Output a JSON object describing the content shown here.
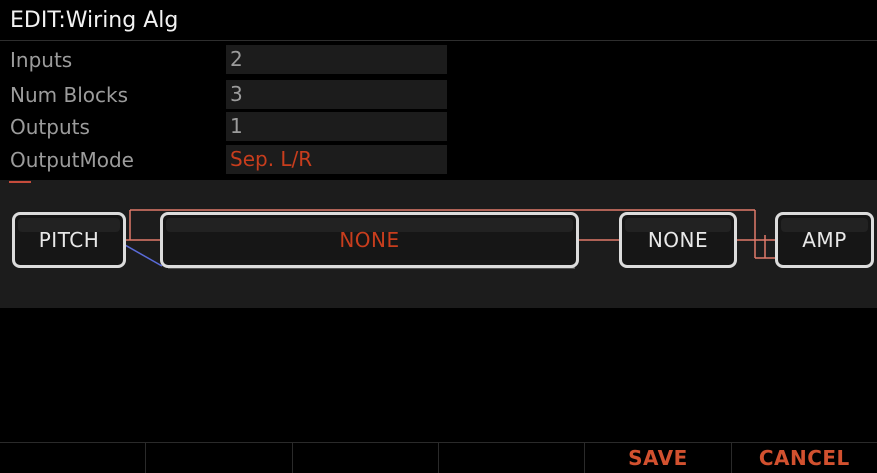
{
  "title": "EDIT:Wiring Alg",
  "params": [
    {
      "label": "Inputs",
      "value": "2"
    },
    {
      "label": "Num Blocks",
      "value": "3"
    },
    {
      "label": "Outputs",
      "value": "1"
    },
    {
      "label": "OutputMode",
      "value": "Sep. L/R"
    }
  ],
  "blocks": {
    "pitch": "PITCH",
    "main": "NONE",
    "second": "NONE",
    "amp": "AMP"
  },
  "softkeys": [
    "",
    "",
    "",
    "",
    "SAVE",
    "CANCEL"
  ],
  "colors": {
    "accent": "#c83d1d",
    "wire": "#e07a6a",
    "wire_blue": "#5a6bd8",
    "panel": "#1c1c1c",
    "label": "#9c9c9c"
  }
}
